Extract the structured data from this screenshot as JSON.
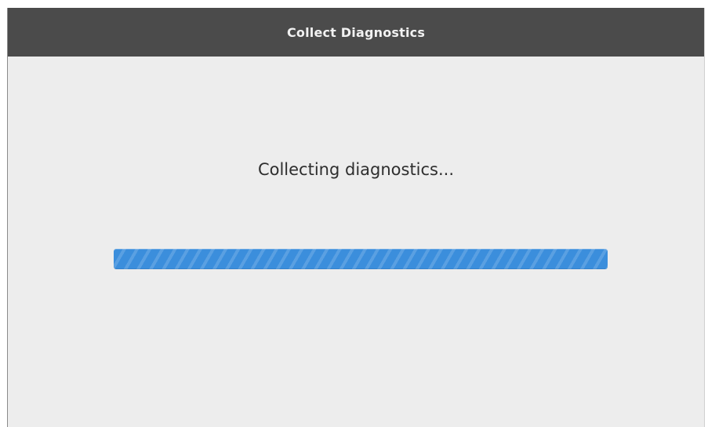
{
  "window": {
    "title": "Collect Diagnostics"
  },
  "main": {
    "status_text": "Collecting diagnostics...",
    "progress": {
      "fraction": 1.0,
      "color": "#3b8edc",
      "style": "striped-activity"
    }
  },
  "colors": {
    "titlebar": "#4b4b4b",
    "background": "#ededed",
    "accent": "#3b8edc"
  }
}
